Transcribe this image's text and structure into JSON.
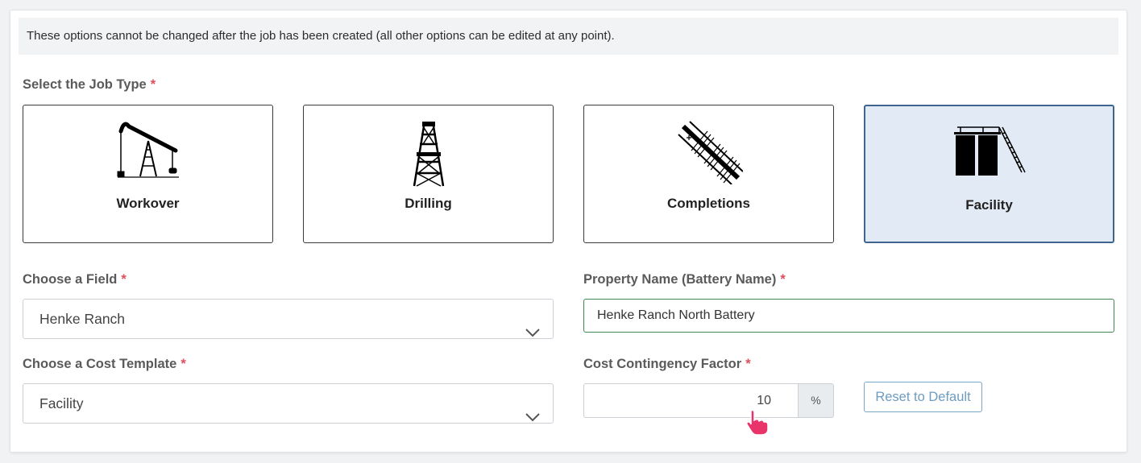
{
  "notice": "These options cannot be changed after the job has been created (all other options can be edited at any point).",
  "required_mark": "*",
  "job_type": {
    "label": "Select the Job Type",
    "options": [
      {
        "name": "Workover",
        "icon": "pumpjack-icon",
        "selected": false
      },
      {
        "name": "Drilling",
        "icon": "drilling-rig-icon",
        "selected": false
      },
      {
        "name": "Completions",
        "icon": "completions-icon",
        "selected": false
      },
      {
        "name": "Facility",
        "icon": "tank-battery-icon",
        "selected": true
      }
    ]
  },
  "field": {
    "label": "Choose a Field",
    "value": "Henke Ranch"
  },
  "property_name": {
    "label": "Property Name (Battery Name)",
    "value": "Henke Ranch North Battery"
  },
  "cost_template": {
    "label": "Choose a Cost Template",
    "value": "Facility"
  },
  "contingency": {
    "label": "Cost Contingency Factor",
    "value": "10",
    "unit": "%"
  },
  "reset_button": "Reset to Default",
  "colors": {
    "selected_bg": "#e2ebf5",
    "selected_border": "#3d6590",
    "required": "#e04e5a",
    "valid_border": "#3c8a4d",
    "cursor": "#e8336b"
  }
}
